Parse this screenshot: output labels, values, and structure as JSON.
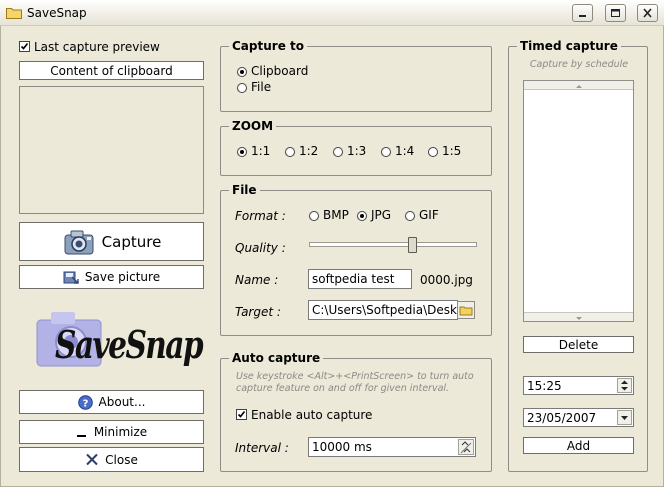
{
  "window": {
    "title": "SaveSnap"
  },
  "left": {
    "preview_checkbox_label": "Last capture preview",
    "preview_checked": true,
    "content_button": "Content of clipboard",
    "capture_button": "Capture",
    "save_button": "Save picture",
    "logo_text": "SaveSnap",
    "about_button": "About...",
    "minimize_button": "Minimize",
    "close_button": "Close"
  },
  "capture_to": {
    "title": "Capture to",
    "options": [
      "Clipboard",
      "File"
    ],
    "selected": "Clipboard"
  },
  "zoom": {
    "title": "ZOOM",
    "options": [
      "1:1",
      "1:2",
      "1:3",
      "1:4",
      "1:5"
    ],
    "selected": "1:1"
  },
  "file": {
    "title": "File",
    "format_label": "Format :",
    "formats": [
      "BMP",
      "JPG",
      "GIF"
    ],
    "selected_format": "JPG",
    "quality_label": "Quality :",
    "quality_level": 0.62,
    "name_label": "Name :",
    "name_value": "softpedia test",
    "name_suffix": "0000.jpg",
    "target_label": "Target :",
    "target_value": "C:\\Users\\Softpedia\\Deskt"
  },
  "auto_capture": {
    "title": "Auto capture",
    "hint": "Use keystroke <Alt>+<PrintScreen> to turn auto capture feature on and off for given interval.",
    "enable_label": "Enable auto capture",
    "enabled": true,
    "interval_label": "Interval :",
    "interval_value": "10000 ms"
  },
  "timed_capture": {
    "title": "Timed capture",
    "subtitle": "Capture by schedule",
    "delete_button": "Delete",
    "time_value": "15:25",
    "date_value": "23/05/2007",
    "add_button": "Add"
  },
  "colors": {
    "background": "#ece9d8",
    "border": "#8f8e88"
  }
}
